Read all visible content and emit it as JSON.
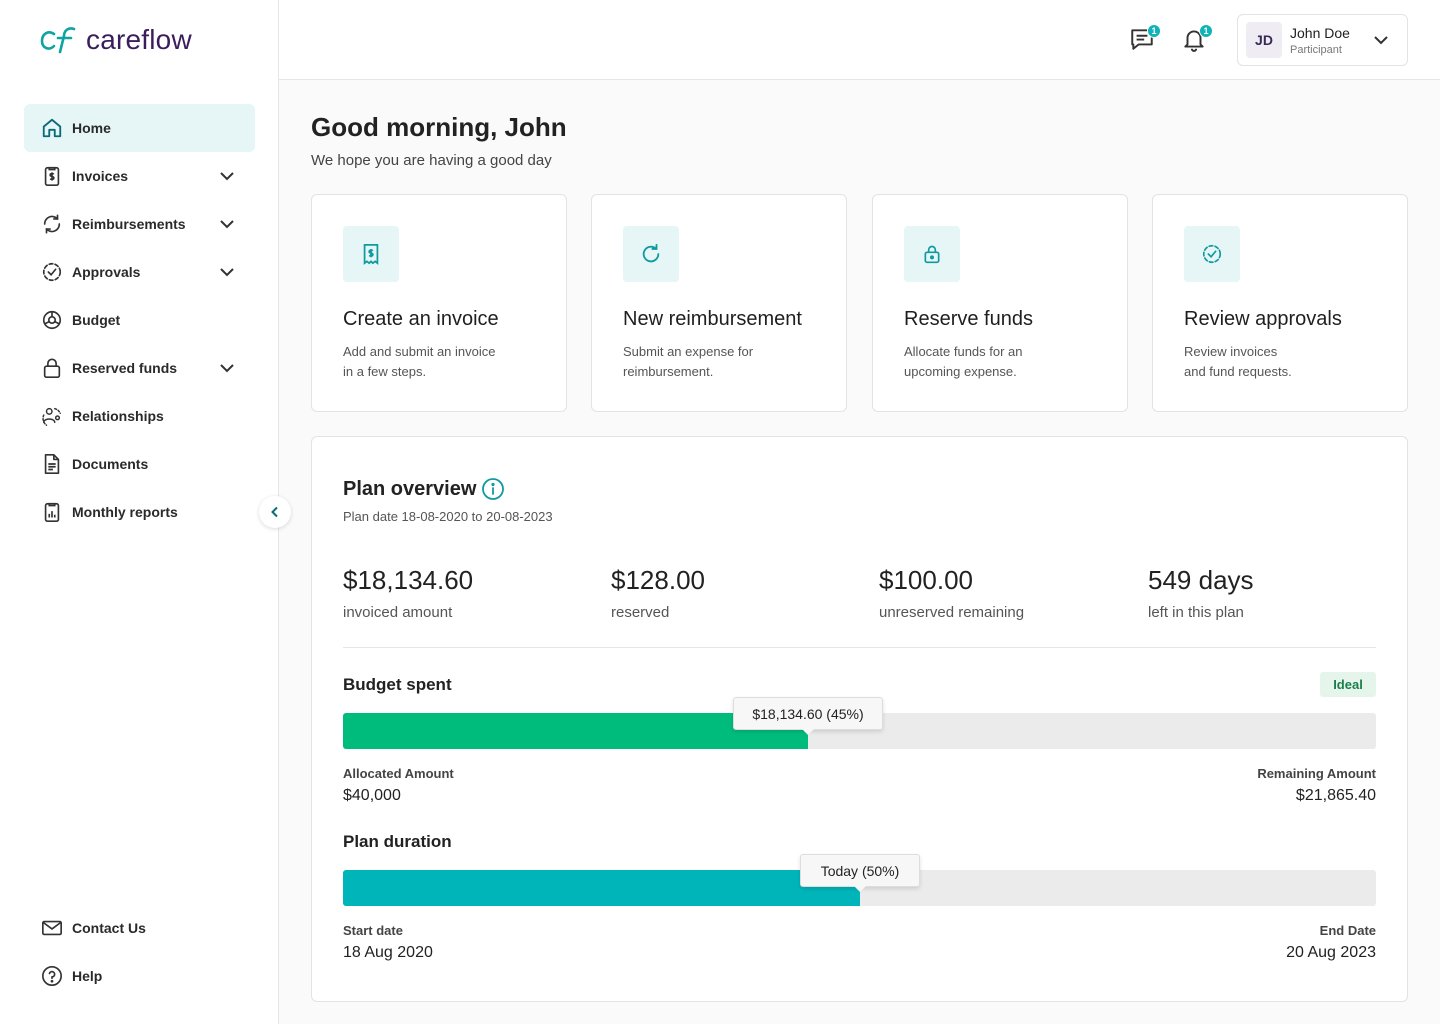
{
  "app": {
    "logo_text": "careflow"
  },
  "sidebar": {
    "items": [
      {
        "label": "Home",
        "active": true
      },
      {
        "label": "Invoices",
        "expandable": true
      },
      {
        "label": "Reimbursements",
        "expandable": true
      },
      {
        "label": "Approvals",
        "expandable": true
      },
      {
        "label": "Budget"
      },
      {
        "label": "Reserved funds",
        "expandable": true
      },
      {
        "label": "Relationships"
      },
      {
        "label": "Documents"
      },
      {
        "label": "Monthly reports"
      }
    ],
    "bottom": [
      {
        "label": "Contact Us"
      },
      {
        "label": "Help"
      }
    ]
  },
  "header": {
    "messages_count": "1",
    "notifications_count": "1",
    "user": {
      "initials": "JD",
      "name": "John Doe",
      "role": "Participant"
    }
  },
  "main": {
    "greeting": "Good morning, John",
    "subtitle": "We hope you are having a good day",
    "cards": [
      {
        "title": "Create an invoice",
        "desc": "Add and submit an invoice\nin a few steps.",
        "icon": "invoice-icon"
      },
      {
        "title": "New reimbursement",
        "desc": "Submit an expense for\nreimbursement.",
        "icon": "refresh-icon"
      },
      {
        "title": "Reserve funds",
        "desc": "Allocate funds for an\nupcoming expense.",
        "icon": "lock-icon"
      },
      {
        "title": "Review approvals",
        "desc": "Review invoices\nand fund requests.",
        "icon": "check-circle-icon"
      }
    ]
  },
  "plan": {
    "title": "Plan overview",
    "date_range": "Plan date 18-08-2020 to 20-08-2023",
    "stats": [
      {
        "value": "$18,134.60",
        "label": "invoiced amount"
      },
      {
        "value": "$128.00",
        "label": "reserved"
      },
      {
        "value": "$100.00",
        "label": "unreserved remaining"
      },
      {
        "value": "549 days",
        "label": "left in this plan"
      }
    ],
    "budget": {
      "title": "Budget spent",
      "status": "Ideal",
      "progress": 0.45,
      "tooltip": "$18,134.60 (45%)",
      "allocated_label": "Allocated Amount",
      "allocated_value": "$40,000",
      "remaining_label": "Remaining Amount",
      "remaining_value": "$21,865.40",
      "color": "#00bc7c"
    },
    "duration": {
      "title": "Plan duration",
      "progress": 0.5,
      "tooltip": "Today (50%)",
      "start_label": "Start date",
      "start_value": "18 Aug 2020",
      "end_label": "End Date",
      "end_value": "20 Aug 2023",
      "color": "#00b5b9"
    }
  },
  "colors": {
    "accent": "#10a2a6",
    "active_bg": "#e6f6f6",
    "brand_text": "#3b1d5c"
  }
}
